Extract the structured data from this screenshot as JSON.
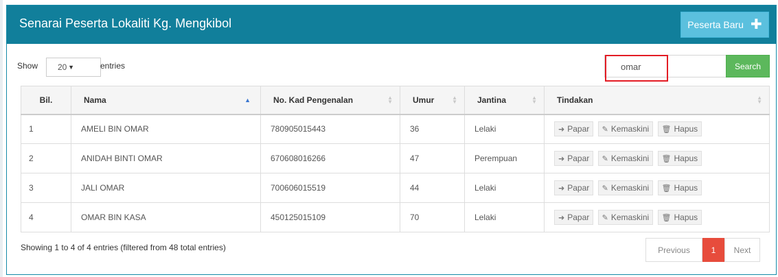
{
  "panel": {
    "title": "Senarai Peserta Lokaliti Kg. Mengkibol",
    "new_button_label": "Peserta Baru"
  },
  "controls": {
    "show_label": "Show",
    "entries_value": "20",
    "entries_label": "entries",
    "search_value": "omar",
    "search_button_label": "Search"
  },
  "table": {
    "headers": [
      "Bil.",
      "Nama",
      "No. Kad Pengenalan",
      "Umur",
      "Jantina",
      "Tindakan"
    ],
    "rows": [
      {
        "bil": "1",
        "nama": "AMELI BIN OMAR",
        "ic": "780905015443",
        "umur": "36",
        "jantina": "Lelaki"
      },
      {
        "bil": "2",
        "nama": "ANIDAH BINTI OMAR",
        "ic": "670608016266",
        "umur": "47",
        "jantina": "Perempuan"
      },
      {
        "bil": "3",
        "nama": "JALI OMAR",
        "ic": "700606015519",
        "umur": "44",
        "jantina": "Lelaki"
      },
      {
        "bil": "4",
        "nama": "OMAR BIN KASA",
        "ic": "450125015109",
        "umur": "70",
        "jantina": "Lelaki"
      }
    ],
    "actions": {
      "view": "Papar",
      "edit": "Kemaskini",
      "delete": "Hapus"
    }
  },
  "footer": {
    "info": "Showing 1 to 4 of 4 entries (filtered from 48 total entries)",
    "prev": "Previous",
    "current_page": "1",
    "next": "Next"
  },
  "colors": {
    "header_bg": "#117f9b",
    "info_button": "#5bc0de",
    "search_button": "#5cb85c",
    "active_page": "#e74c3c",
    "highlight": "#e31c24"
  },
  "icons": {
    "new": "plus-icon",
    "view": "sign-in-icon",
    "edit": "edit-icon",
    "delete": "trash-icon"
  }
}
